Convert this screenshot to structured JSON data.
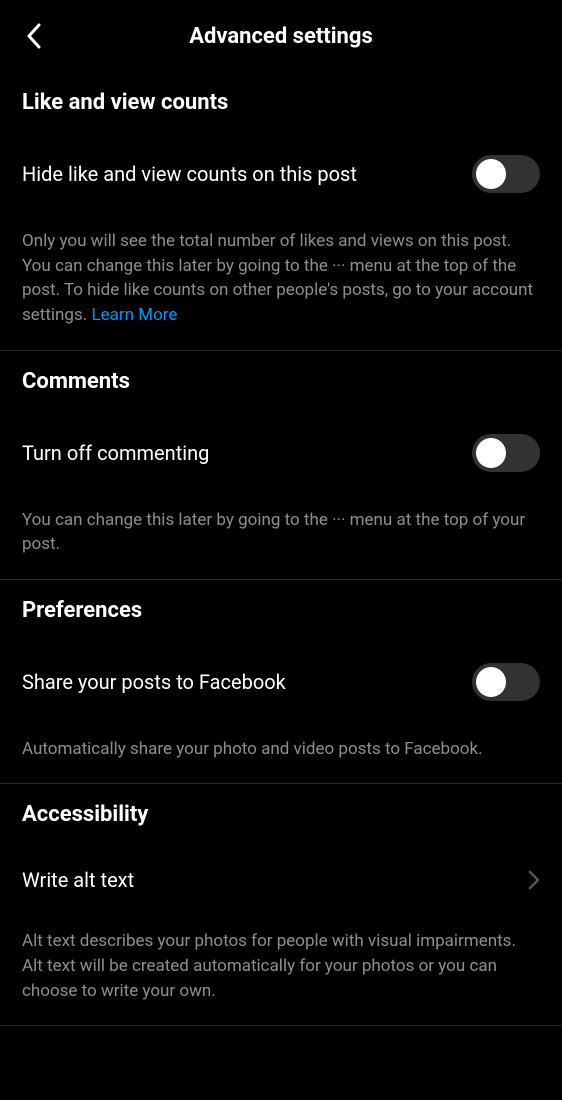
{
  "header": {
    "title": "Advanced settings"
  },
  "sections": {
    "likes": {
      "title": "Like and view counts",
      "toggle_label": "Hide like and view counts on this post",
      "description": "Only you will see the total number of likes and views on this post. You can change this later by going to the ··· menu at the top of the post. To hide like counts on other people's posts, go to your account settings. ",
      "learn_more": "Learn More"
    },
    "comments": {
      "title": "Comments",
      "toggle_label": "Turn off commenting",
      "description": "You can change this later by going to the ··· menu at the top of your post."
    },
    "preferences": {
      "title": "Preferences",
      "toggle_label": "Share your posts to Facebook",
      "description": "Automatically share your photo and video posts to Facebook."
    },
    "accessibility": {
      "title": "Accessibility",
      "nav_label": "Write alt text",
      "description": "Alt text describes your photos for people with visual impairments. Alt text will be created automatically for your photos or you can choose to write your own."
    }
  }
}
